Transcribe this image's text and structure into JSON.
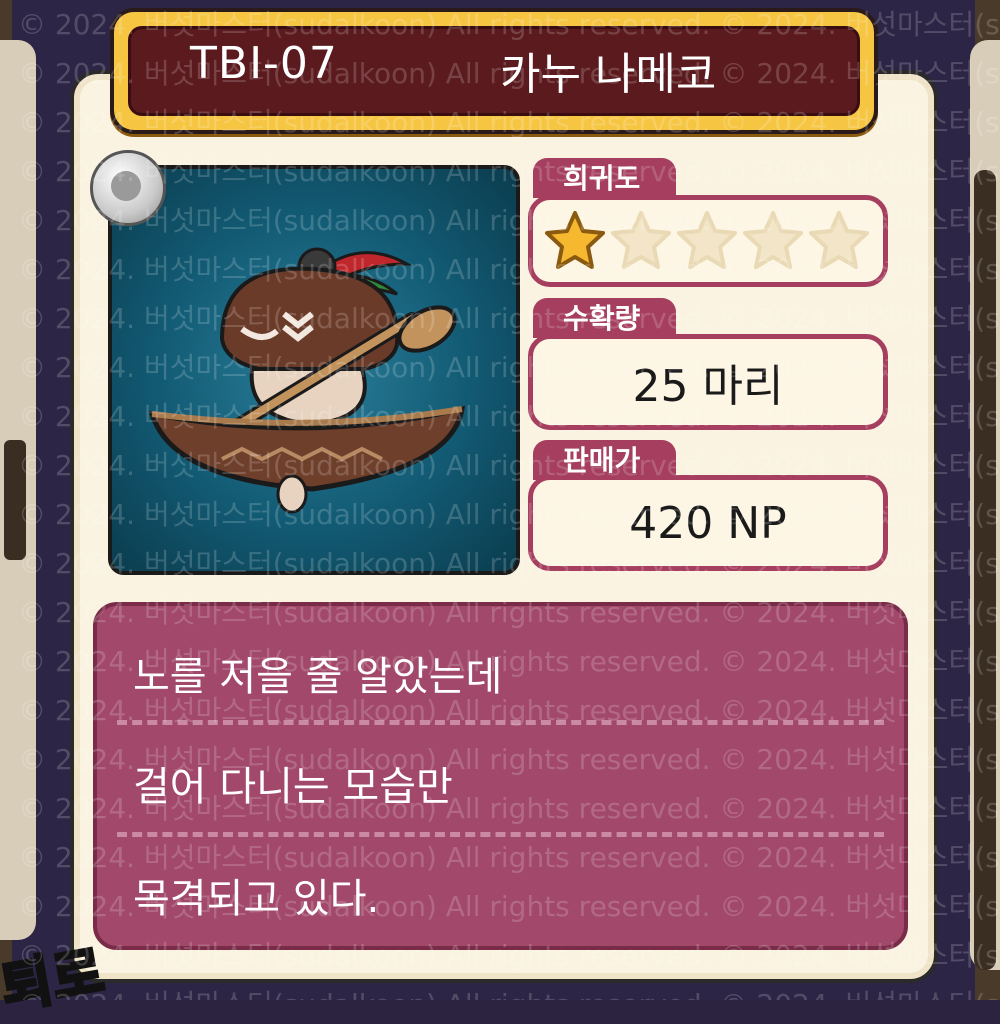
{
  "header": {
    "code": "TBI-07",
    "name": "카누 나메코"
  },
  "stats": {
    "rarity": {
      "label": "희귀도",
      "stars_filled": 1,
      "stars_total": 5
    },
    "harvest": {
      "label": "수확량",
      "value": "25 마리"
    },
    "price": {
      "label": "판매가",
      "value": "420 NP"
    }
  },
  "description": {
    "lines": [
      "노를 저을 줄 알았는데",
      "걸어 다니는 모습만",
      "목격되고 있다."
    ]
  },
  "watermark": "© 2024. 버섯마스터(sudalkoon) All rights reserved.",
  "corner_text": "퇴로",
  "colors": {
    "accent": "#a53e5f",
    "header_gold": "#f6c541",
    "header_dark": "#5b1a1e",
    "portrait_bg": "#125a73",
    "star_filled": "#f5b82e",
    "star_empty": "#f3e6c8"
  }
}
